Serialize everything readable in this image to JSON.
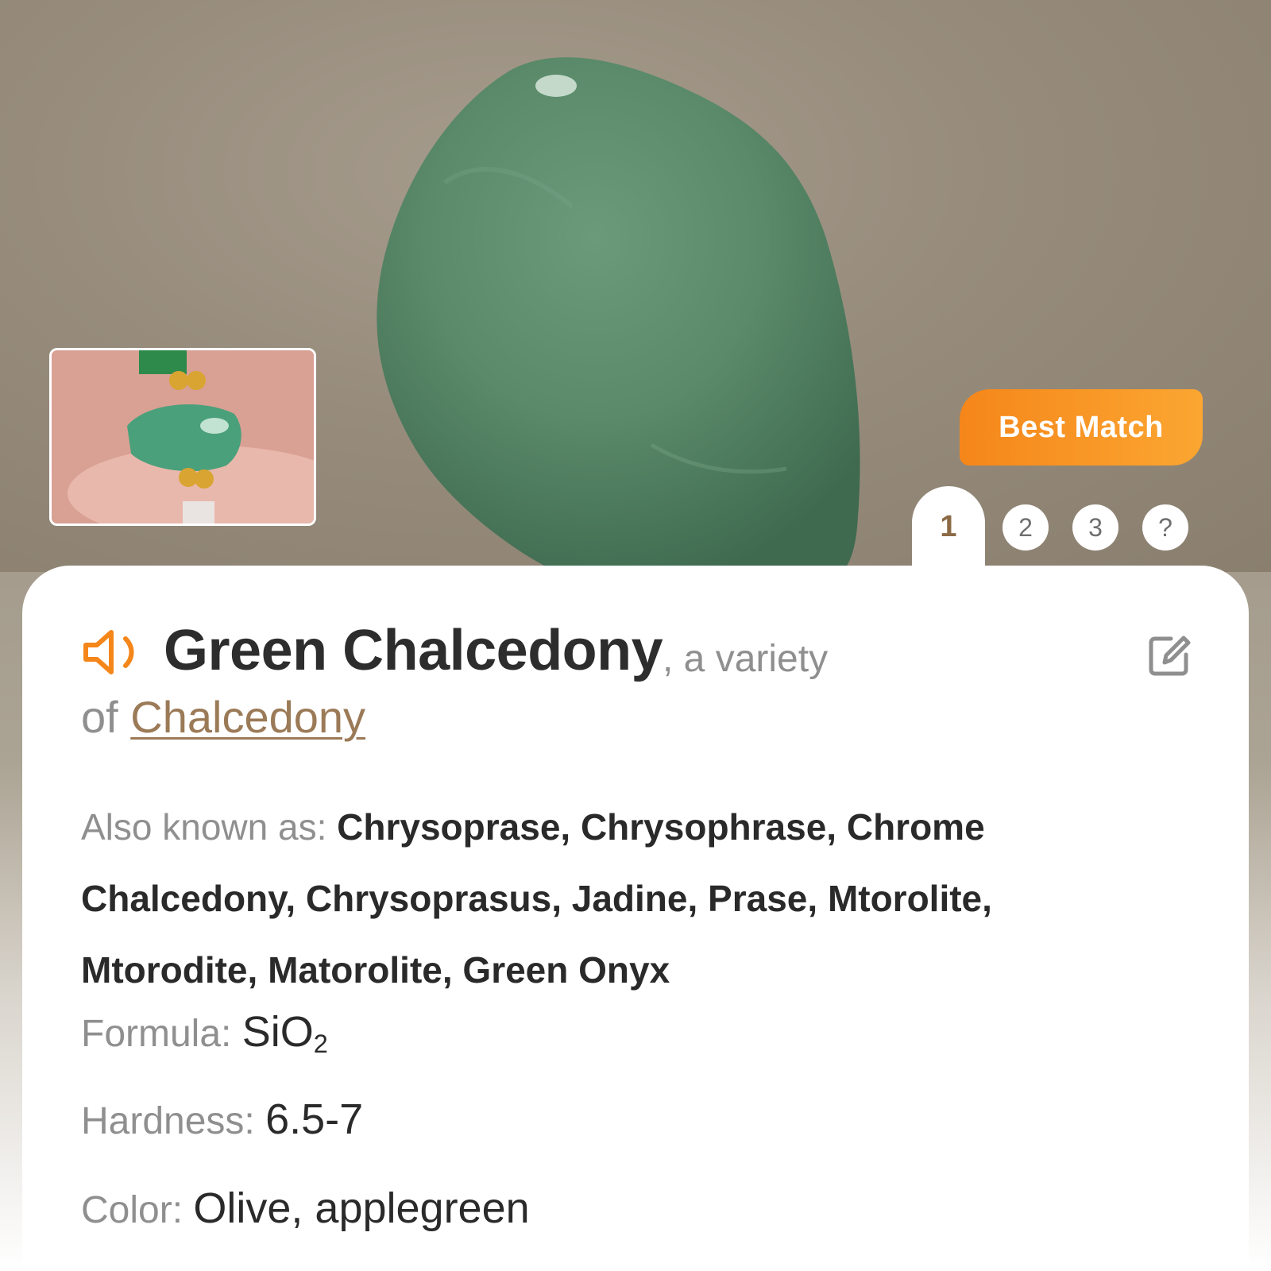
{
  "badge": {
    "best_match": "Best Match"
  },
  "tabs": [
    {
      "label": "1",
      "active": true
    },
    {
      "label": "2",
      "active": false
    },
    {
      "label": "3",
      "active": false
    },
    {
      "label": "?",
      "active": false
    }
  ],
  "result": {
    "name": "Green Chalcedony",
    "variety_text": ", a variety",
    "of_text": "of ",
    "parent": "Chalcedony",
    "also_known_as_label": "Also known as: ",
    "also_known_as": "Chrysoprase, Chrysophrase, Chrome Chalcedony, Chrysoprasus, Jadine, Prase, Mtorolite, Mtorodite, Matorolite, Green Onyx",
    "formula_label": "Formula: ",
    "formula_main": "SiO",
    "formula_sub": "2",
    "hardness_label": "Hardness: ",
    "hardness": "6.5-7",
    "color_label": "Color: ",
    "color": "Olive, applegreen"
  },
  "icons": {
    "speaker": "speaker-icon",
    "edit": "edit-icon"
  },
  "colors": {
    "accent": "#f5861a",
    "link": "#9b7a57",
    "stone": "#5b8a6a"
  }
}
